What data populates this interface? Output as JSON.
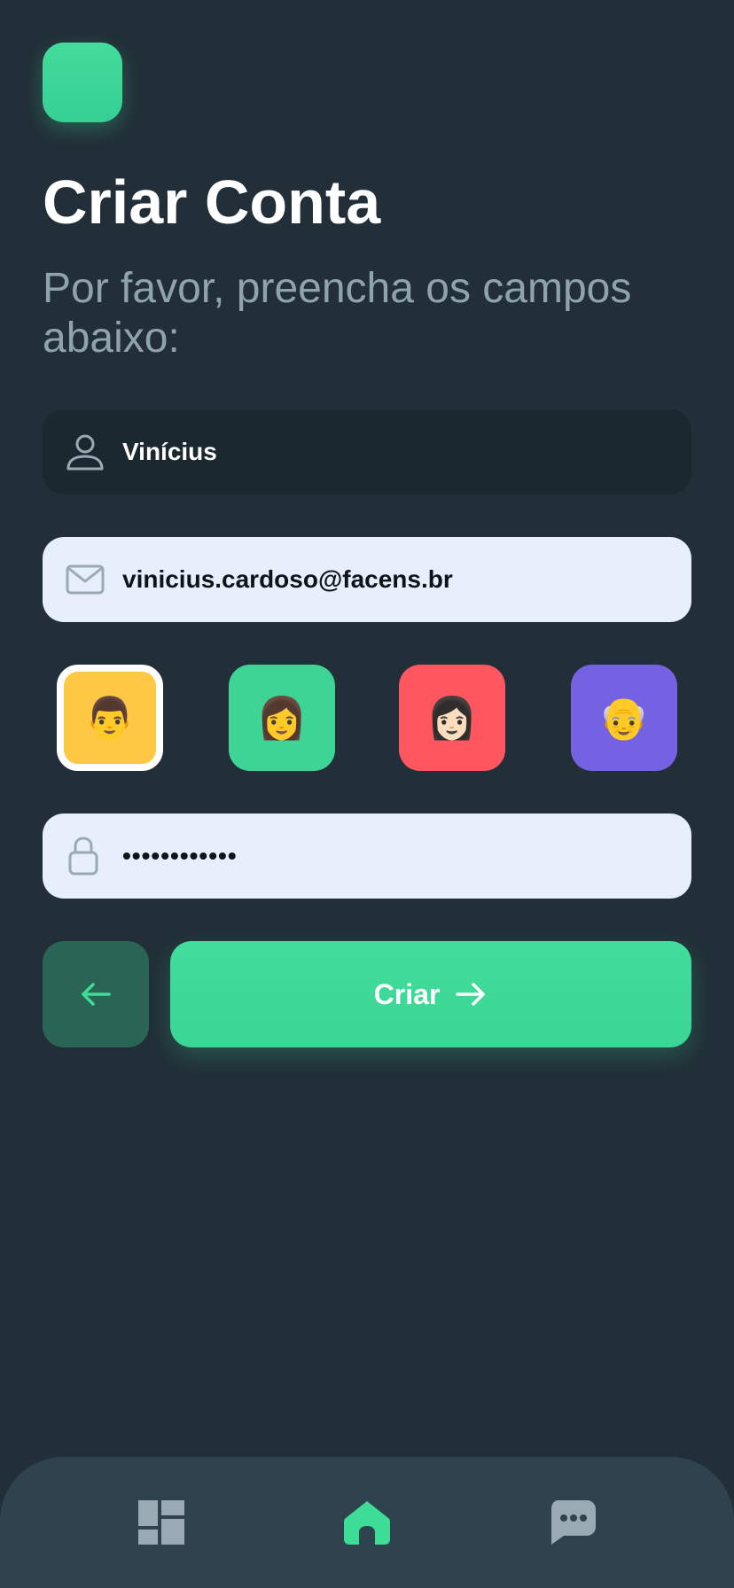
{
  "page": {
    "title": "Criar Conta",
    "subtitle": "Por favor, preencha os campos abaixo:"
  },
  "form": {
    "name": {
      "value": "Vinícius",
      "icon": "user-icon"
    },
    "email": {
      "value": "vinicius.cardoso@facens.br",
      "icon": "mail-icon"
    },
    "password": {
      "value": "••••••••••••",
      "icon": "lock-icon"
    }
  },
  "avatars": [
    {
      "emoji": "👨",
      "bg": "#ffc844",
      "selected": true
    },
    {
      "emoji": "👩",
      "bg": "#3dd495",
      "selected": false
    },
    {
      "emoji": "👩🏻",
      "bg": "#ff5660",
      "selected": false
    },
    {
      "emoji": "👴",
      "bg": "#7562e3",
      "selected": false
    }
  ],
  "actions": {
    "back_icon": "arrow-left-icon",
    "submit_label": "Criar",
    "submit_icon": "arrow-right-icon"
  },
  "nav": {
    "items": [
      {
        "icon": "dashboard-icon",
        "active": false
      },
      {
        "icon": "home-icon",
        "active": true
      },
      {
        "icon": "chat-icon",
        "active": false
      }
    ]
  },
  "colors": {
    "background": "#222f38",
    "accent": "#3ddc97",
    "nav_background": "#2f434f",
    "field_light": "#e7effd",
    "field_dark": "#1c2830",
    "subtitle": "#8fa3ae",
    "icon_muted": "#9aaab5"
  }
}
